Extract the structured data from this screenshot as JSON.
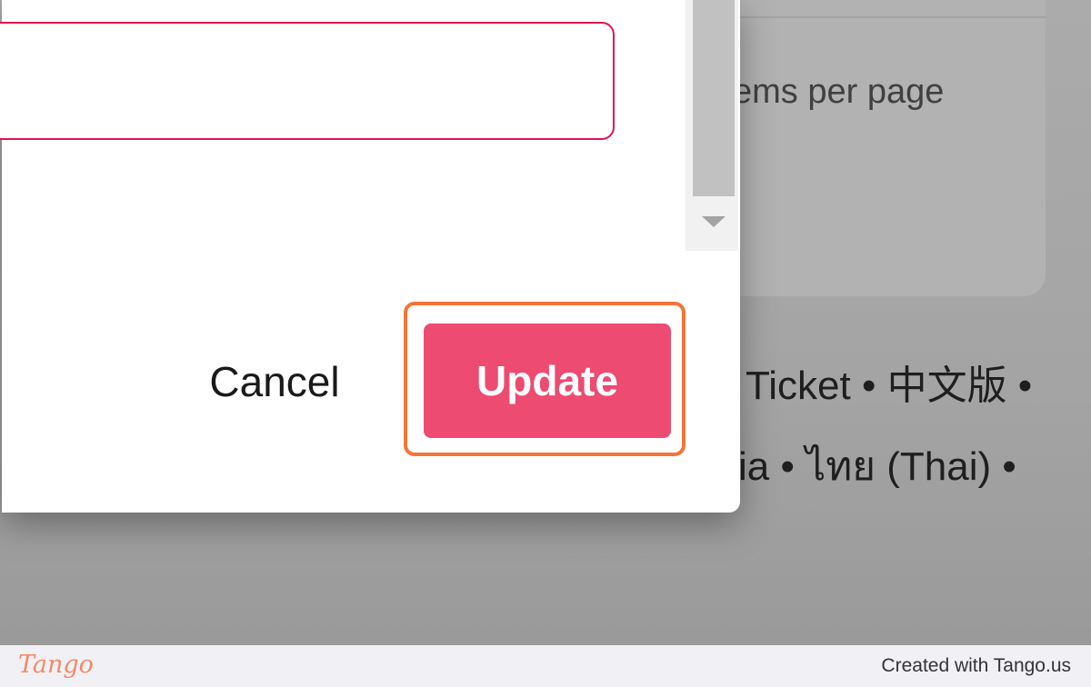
{
  "background_page": {
    "items_per_page_text": "ems per page",
    "footer_line1": "Ticket • 中文版 •",
    "footer_line2": "ia • ไทย (Thai) •"
  },
  "dialog": {
    "input": {
      "value": ""
    },
    "actions": {
      "cancel_label": "Cancel",
      "update_label": "Update"
    }
  },
  "watermark": {
    "logo_text": "Tango",
    "credit_text": "Created with Tango.us"
  },
  "colors": {
    "primary_button": "#ed4b72",
    "input_border": "#e0144f",
    "highlight_outline": "#f37438",
    "tango_logo": "#f28a6a"
  },
  "icons": {
    "scroll_down": "scroll-down-arrow-icon"
  }
}
